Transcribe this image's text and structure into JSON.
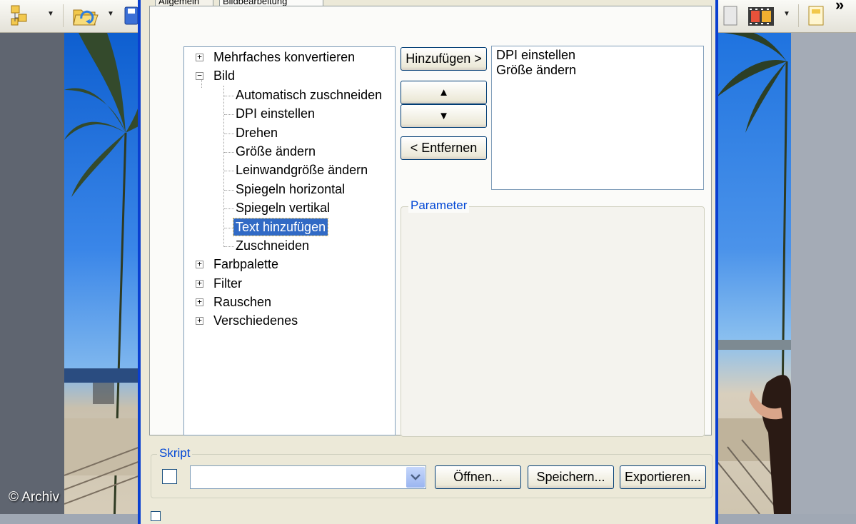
{
  "tabs": [
    "Allgemein",
    "Bildbearbeitung"
  ],
  "tree": [
    {
      "label": "Mehrfaches konvertieren"
    },
    {
      "label": "Bild"
    },
    {
      "label": "Automatisch zuschneiden"
    },
    {
      "label": "DPI einstellen"
    },
    {
      "label": "Drehen"
    },
    {
      "label": "Größe ändern"
    },
    {
      "label": "Leinwandgröße ändern"
    },
    {
      "label": "Spiegeln horizontal"
    },
    {
      "label": "Spiegeln vertikal"
    },
    {
      "label": "Text hinzufügen"
    },
    {
      "label": "Zuschneiden"
    },
    {
      "label": "Farbpalette"
    },
    {
      "label": "Filter"
    },
    {
      "label": "Rauschen"
    },
    {
      "label": "Verschiedenes"
    }
  ],
  "buttons": {
    "add": "Hinzufügen >",
    "up": "▲",
    "down": "▼",
    "remove": "< Entfernen",
    "open": "Öffnen...",
    "save": "Speichern...",
    "export": "Exportieren..."
  },
  "steps": [
    "DPI einstellen",
    "Größe ändern"
  ],
  "groups": {
    "parameter": "Parameter",
    "script": "Skript"
  },
  "script": {
    "value": ""
  },
  "watermark": "© Archiv",
  "toolbar": {
    "overflow": "»"
  },
  "colors": {
    "dialog_bg": "#ece9d8",
    "xp_blue": "#0a3fd0",
    "selection": "#316ac5",
    "group_title": "#0046d5"
  }
}
